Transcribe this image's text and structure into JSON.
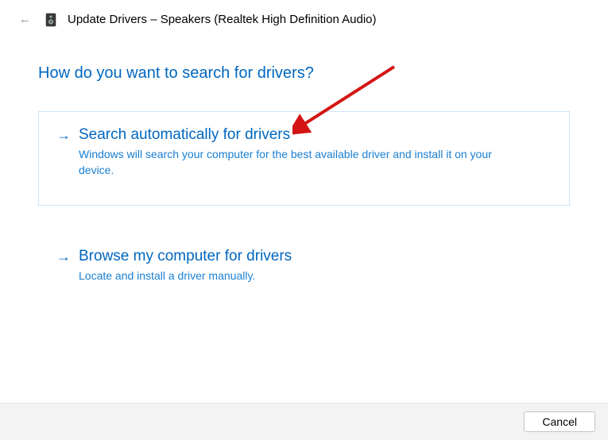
{
  "titlebar": {
    "title": "Update Drivers – Speakers (Realtek High Definition Audio)"
  },
  "heading": "How do you want to search for drivers?",
  "options": {
    "auto": {
      "title": "Search automatically for drivers",
      "desc": "Windows will search your computer for the best available driver and install it on your device."
    },
    "browse": {
      "title": "Browse my computer for drivers",
      "desc": "Locate and install a driver manually."
    }
  },
  "footer": {
    "cancel_label": "Cancel"
  }
}
